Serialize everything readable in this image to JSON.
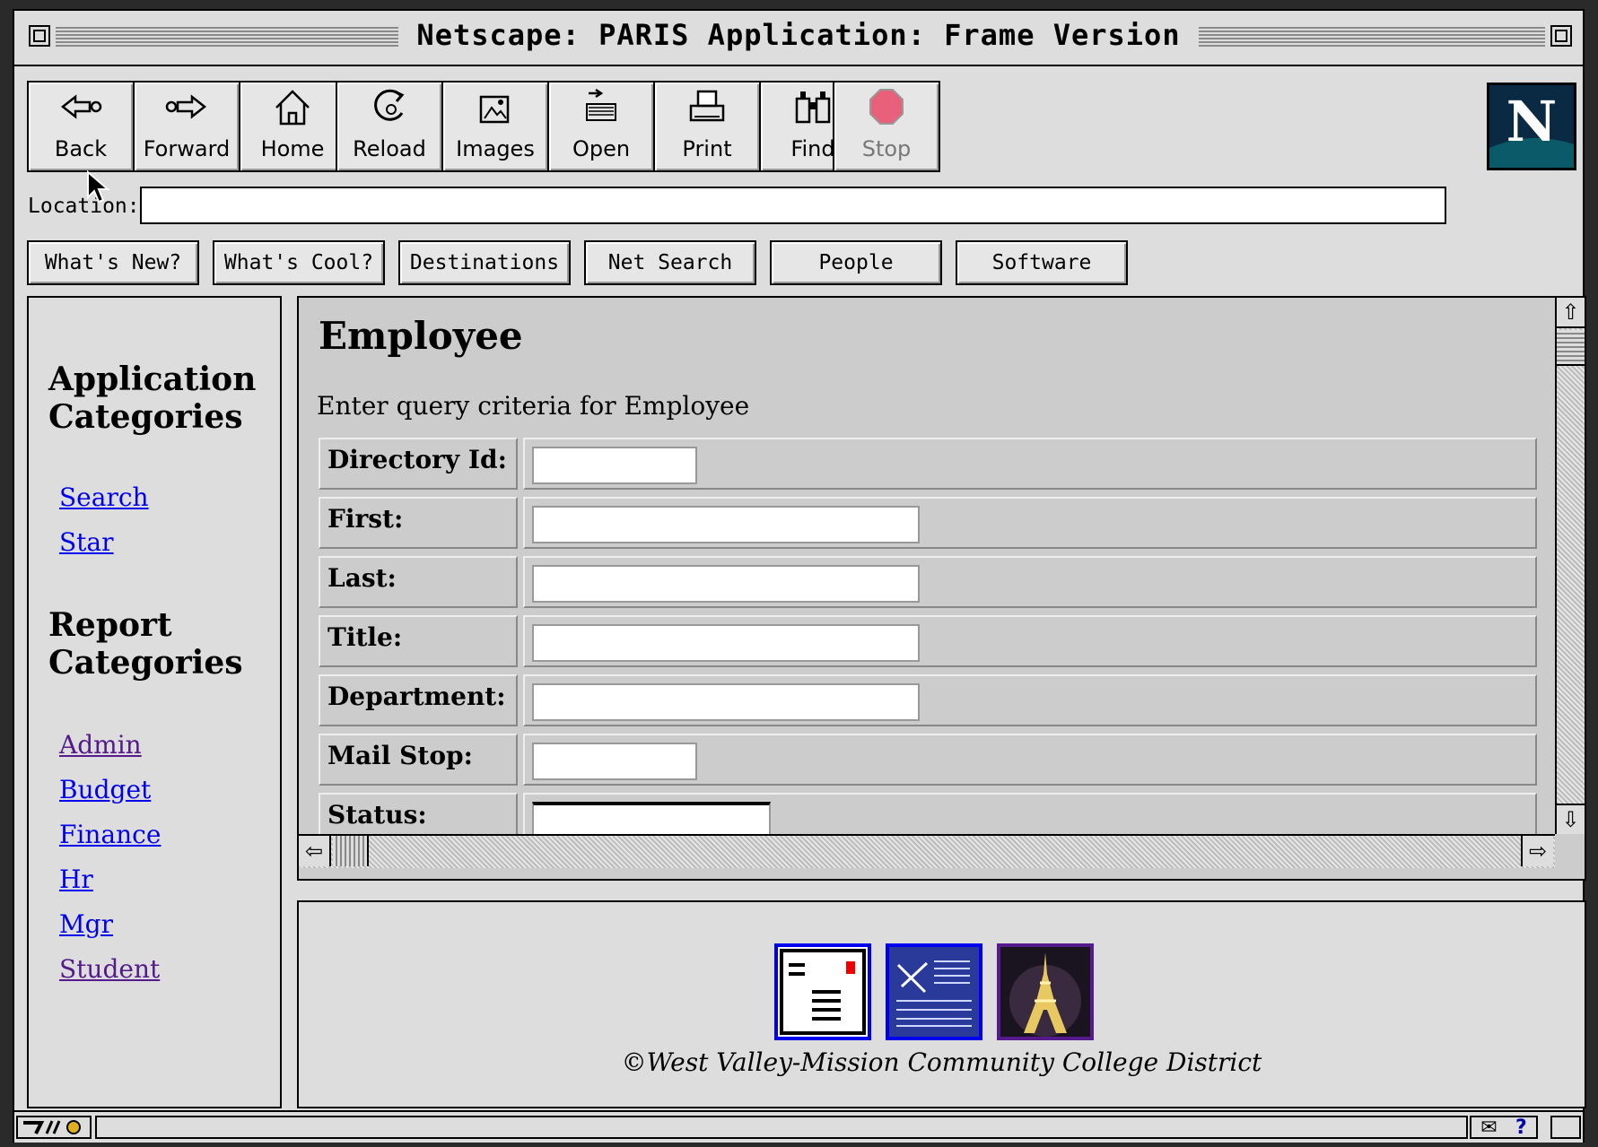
{
  "window": {
    "title": "Netscape: PARIS Application: Frame Version"
  },
  "toolbar": {
    "back": "Back",
    "forward": "Forward",
    "home": "Home",
    "reload": "Reload",
    "images": "Images",
    "open": "Open",
    "print": "Print",
    "find": "Find",
    "stop": "Stop"
  },
  "location": {
    "label": "Location:",
    "value": ""
  },
  "directory_buttons": [
    "What's New?",
    "What's Cool?",
    "Destinations",
    "Net Search",
    "People",
    "Software"
  ],
  "left_frame": {
    "app_heading_1": "Application",
    "app_heading_2": "Categories",
    "app_links": [
      "Search",
      "Star"
    ],
    "report_heading_1": "Report",
    "report_heading_2": "Categories",
    "report_links": [
      "Admin",
      "Budget",
      "Finance",
      "Hr",
      "Mgr",
      "Student"
    ]
  },
  "main_frame": {
    "title": "Employee",
    "subtitle": "Enter query criteria for Employee",
    "fields": [
      {
        "label": "Directory Id:",
        "value": ""
      },
      {
        "label": "First:",
        "value": ""
      },
      {
        "label": "Last:",
        "value": ""
      },
      {
        "label": "Title:",
        "value": ""
      },
      {
        "label": "Department:",
        "value": ""
      },
      {
        "label": "Mail Stop:",
        "value": ""
      },
      {
        "label": "Status:",
        "value": ""
      }
    ]
  },
  "footer": {
    "copyright": "©West Valley-Mission Community College District"
  },
  "colors": {
    "link_unvisited": "#0000ee",
    "link_visited": "#551a8b",
    "stop_red": "#e8607a"
  }
}
